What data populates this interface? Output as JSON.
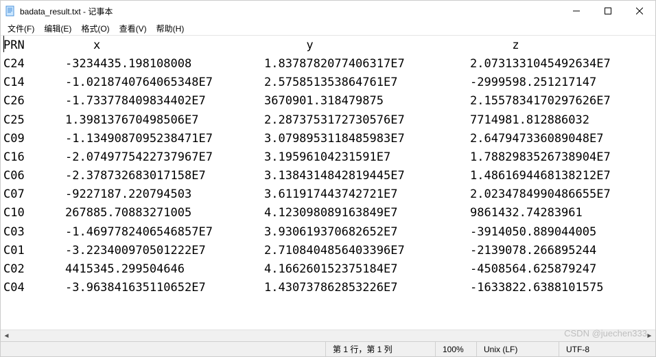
{
  "window": {
    "title": "badata_result.txt - 记事本"
  },
  "menu": {
    "items": [
      {
        "label": "文件(F)"
      },
      {
        "label": "编辑(E)"
      },
      {
        "label": "格式(O)"
      },
      {
        "label": "查看(V)"
      },
      {
        "label": "帮助(H)"
      }
    ]
  },
  "header": {
    "prn": "PRN",
    "x": "x",
    "y": "y",
    "z": "z"
  },
  "rows": [
    {
      "prn": "C24",
      "x": "-3234435.198108008",
      "y": "1.8378782077406317E7",
      "z": "2.0731331045492634E7"
    },
    {
      "prn": "C14",
      "x": "-1.0218740764065348E7",
      "y": "2.575851353864761E7",
      "z": "-2999598.251217147"
    },
    {
      "prn": "C26",
      "x": "-1.733778409834402E7",
      "y": "3670901.318479875",
      "z": "2.1557834170297626E7"
    },
    {
      "prn": "C25",
      "x": "1.398137670498506E7",
      "y": "2.2873753172730576E7",
      "z": "7714981.812886032"
    },
    {
      "prn": "C09",
      "x": "-1.1349087095238471E7",
      "y": "3.0798953118485983E7",
      "z": "2.647947336089048E7"
    },
    {
      "prn": "C16",
      "x": "-2.0749775422737967E7",
      "y": "3.19596104231591E7",
      "z": "1.7882983526738904E7"
    },
    {
      "prn": "C06",
      "x": "-2.378732683017158E7",
      "y": "3.1384314842819445E7",
      "z": "1.4861694468138212E7"
    },
    {
      "prn": "C07",
      "x": "-9227187.220794503",
      "y": "3.611917443742721E7",
      "z": "2.0234784990486655E7"
    },
    {
      "prn": "C10",
      "x": "267885.70883271005",
      "y": "4.123098089163849E7",
      "z": "9861432.74283961"
    },
    {
      "prn": "C03",
      "x": "-1.4697782406546857E7",
      "y": "3.930619370682652E7",
      "z": "-3914050.889044005"
    },
    {
      "prn": "C01",
      "x": "-3.223400970501222E7",
      "y": "2.7108404856403396E7",
      "z": "-2139078.266895244"
    },
    {
      "prn": "C02",
      "x": "4415345.299504646",
      "y": "4.166260152375184E7",
      "z": "-4508564.625879247"
    },
    {
      "prn": "C04",
      "x": "-3.963841635110652E7",
      "y": "1.430737862853226E7",
      "z": "-1633822.6388101575"
    }
  ],
  "status": {
    "position": "第 1 行，第 1 列",
    "zoom": "100%",
    "eol": "Unix (LF)",
    "encoding": "UTF-8"
  },
  "watermark": "CSDN @juechen333"
}
